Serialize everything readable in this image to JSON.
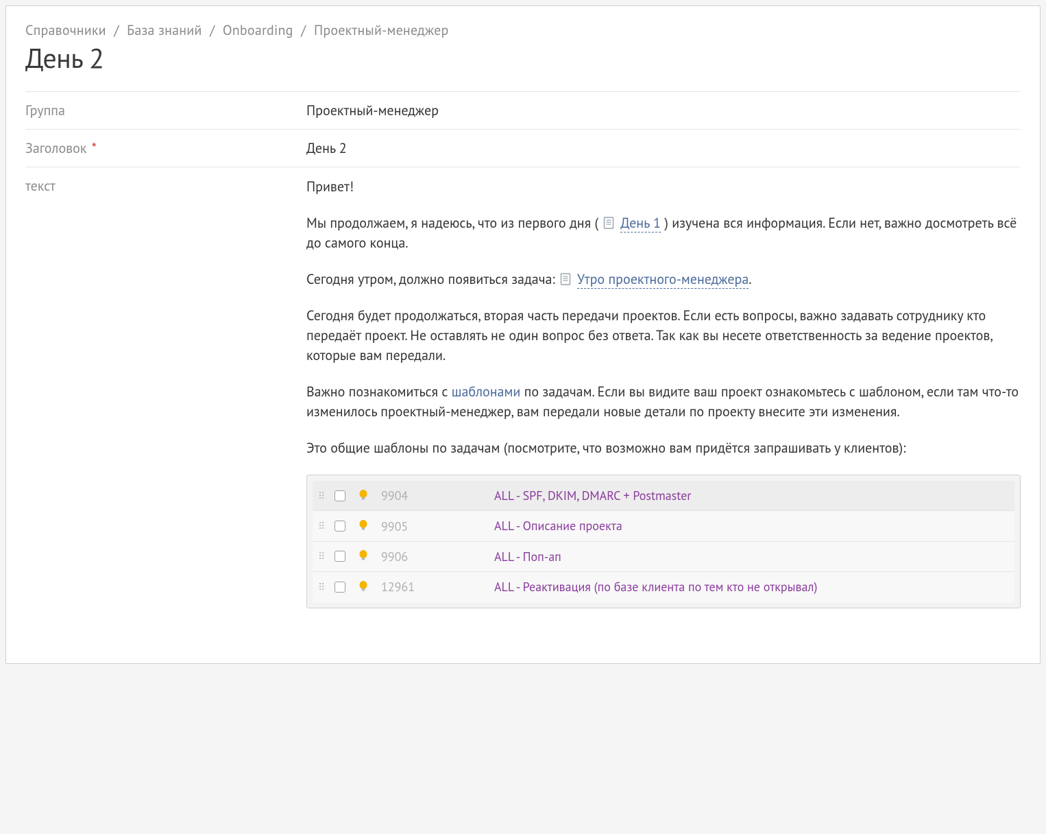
{
  "breadcrumb": {
    "items": [
      "Справочники",
      "База знаний",
      "Onboarding",
      "Проектный-менеджер"
    ],
    "sep": "/"
  },
  "page_title": "День 2",
  "fields": {
    "group": {
      "label": "Группа",
      "value": "Проектный-менеджер"
    },
    "heading": {
      "label": "Заголовок",
      "required": "*",
      "value": "День 2"
    },
    "text": {
      "label": "текст"
    }
  },
  "content": {
    "greeting": "Привет!",
    "p2_before": "Мы продолжаем, я надеюсь, что из первого дня ( ",
    "p2_link": "День 1",
    "p2_after": " ) изучена вся информация. Если нет, важно досмотреть всё до самого конца.",
    "p3_before": "Сегодня утром, должно появиться задача: ",
    "p3_link": "Утро проектного-менеджера",
    "p3_after": ".",
    "p4": "Сегодня будет продолжаться, вторая часть передачи проектов. Если есть вопросы, важно задавать сотруднику кто передаёт проект. Не оставлять не один вопрос без ответа. Так как вы несете ответственность за ведение проектов, которые вам передали.",
    "p5_before": "Важно познакомиться с ",
    "p5_link": "шаблонами",
    "p5_after": " по задачам. Если вы видите ваш проект ознакомьтесь с шаблоном, если там что-то изменилось проектный-менеджер, вам передали новые детали по проекту внесите эти изменения.",
    "p6": "Это общие шаблоны по задачам (посмотрите, что возможно вам придётся запрашивать у клиентов):"
  },
  "tasks": [
    {
      "id": "9904",
      "title": "ALL - SPF, DKIM, DMARC + Postmaster"
    },
    {
      "id": "9905",
      "title": "ALL - Описание проекта"
    },
    {
      "id": "9906",
      "title": "ALL - Поп-ап"
    },
    {
      "id": "12961",
      "title": "ALL - Реактивация (по базе клиента по тем кто не открывал)"
    }
  ]
}
